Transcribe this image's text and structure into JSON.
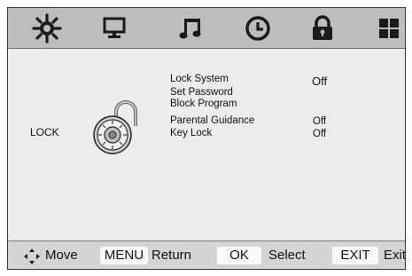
{
  "tabs": [
    {
      "name": "picture",
      "icon": "sun-icon"
    },
    {
      "name": "setup",
      "icon": "monitor-icon"
    },
    {
      "name": "audio",
      "icon": "music-note-icon"
    },
    {
      "name": "time",
      "icon": "clock-icon"
    },
    {
      "name": "lock",
      "icon": "padlock-icon"
    },
    {
      "name": "option",
      "icon": "grid-icon"
    }
  ],
  "section": {
    "label": "LOCK",
    "graphic": "combination-lock-icon"
  },
  "menu": {
    "items": [
      {
        "label": "Lock System",
        "value": "Off"
      },
      {
        "label": "Set Password",
        "value": ""
      },
      {
        "label": "Block Program",
        "value": ""
      },
      {
        "label": "Parental Guidance",
        "value": "Off"
      },
      {
        "label": "Key Lock",
        "value": "Off"
      }
    ]
  },
  "footer": {
    "move_icon": "four-way-arrow-icon",
    "move_label": "Move",
    "menu_key": "MENU",
    "menu_label": "Return",
    "ok_key": "OK",
    "ok_label": "Select",
    "exit_key": "EXIT",
    "exit_label": "Exit"
  },
  "colors": {
    "topbar": "#bdbdbd",
    "content": "#ececec",
    "footer": "#d5d5d5",
    "icon": "#1a1a1a"
  }
}
